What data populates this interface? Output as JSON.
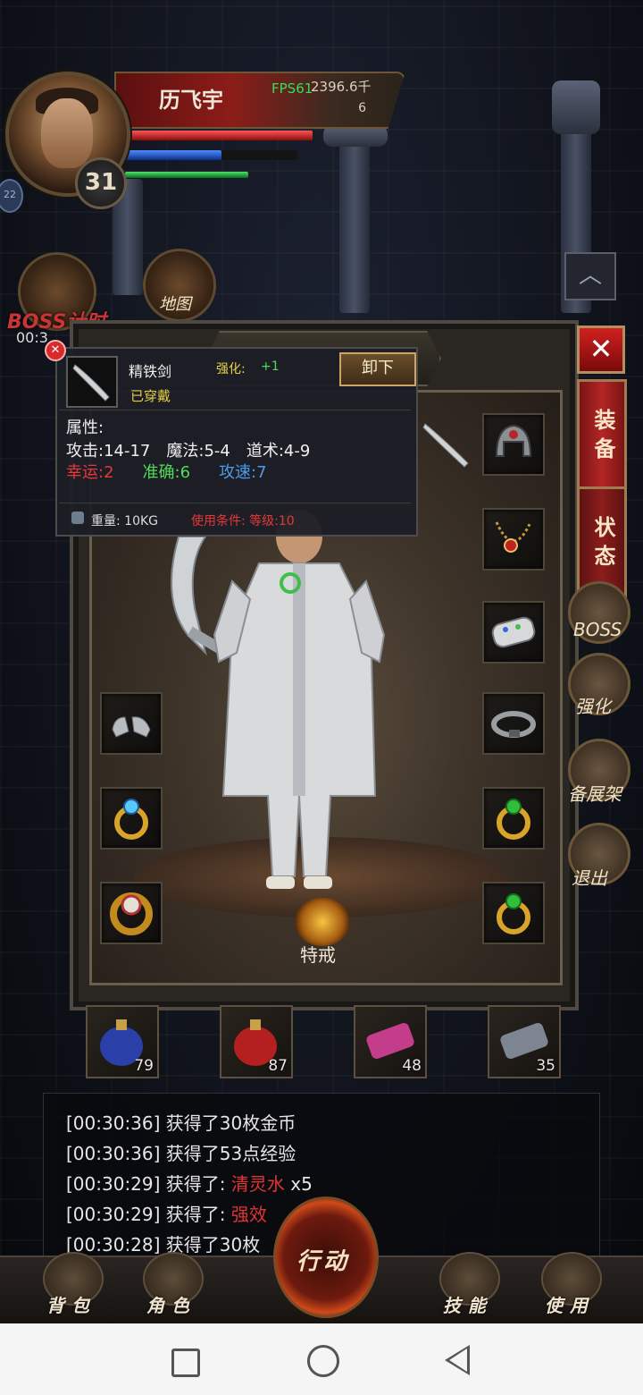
{
  "player": {
    "name": "历飞宇",
    "level": "31",
    "fps": "FPS61",
    "gold": "2396.6千",
    "ingots": "6",
    "side_badge": "22"
  },
  "hud": {
    "boss_timer_label": "BOSS计时",
    "boss_timer_value": "00:3",
    "map_label": "地图"
  },
  "panel": {
    "close_label": "✕",
    "tabs": [
      {
        "label": "装备",
        "selected": true
      },
      {
        "label": "状态",
        "selected": false
      }
    ],
    "side_buttons": [
      "BOSS",
      "强化",
      "备展架",
      "退出"
    ],
    "special_ring_label": "特戒"
  },
  "equip_slots": {
    "left": [
      "boots-icon",
      "ring-icon",
      "ring-icon"
    ],
    "right": [
      "helmet-icon",
      "necklace-icon",
      "bracelet-icon",
      "belt-icon",
      "ring-icon",
      "ring-icon"
    ]
  },
  "tooltip": {
    "item_name": "精铁剑",
    "enhance_label": "强化:",
    "enhance_value": "+1",
    "status": "已穿戴",
    "unequip_label": "卸下",
    "attr_title": "属性:",
    "attack": "攻击:14-17",
    "magic": "魔法:5-4",
    "taoism": "道术:4-9",
    "luck": "幸运:2",
    "accuracy": "准确:6",
    "speed": "攻速:7",
    "weight": "重量: 10KG",
    "requirement": "使用条件: 等级:10",
    "colors": {
      "luck": "#e53838",
      "accuracy": "#4fdc56",
      "speed": "#4a9ce8"
    }
  },
  "quick_items": [
    {
      "icon": "blue-potion-icon",
      "count": "79"
    },
    {
      "icon": "red-potion-icon",
      "count": "87"
    },
    {
      "icon": "scroll-pink-icon",
      "count": "48"
    },
    {
      "icon": "scroll-gray-icon",
      "count": "35"
    }
  ],
  "log": [
    {
      "time": "[00:30:36]",
      "text": "获得了30枚金币",
      "item": "",
      "suffix": ""
    },
    {
      "time": "[00:30:36]",
      "text": "获得了53点经验",
      "item": "",
      "suffix": ""
    },
    {
      "time": "[00:30:29]",
      "text": "获得了: ",
      "item": "清灵水",
      "suffix": " x5"
    },
    {
      "time": "[00:30:29]",
      "text": "获得了: ",
      "item": "强效",
      "suffix": ""
    },
    {
      "time": "[00:30:28]",
      "text": "获得了30枚",
      "item": "",
      "suffix": ""
    }
  ],
  "bottom_nav": {
    "bag": "背包",
    "role": "角色",
    "action": "行动",
    "skill": "技能",
    "use": "使用"
  }
}
